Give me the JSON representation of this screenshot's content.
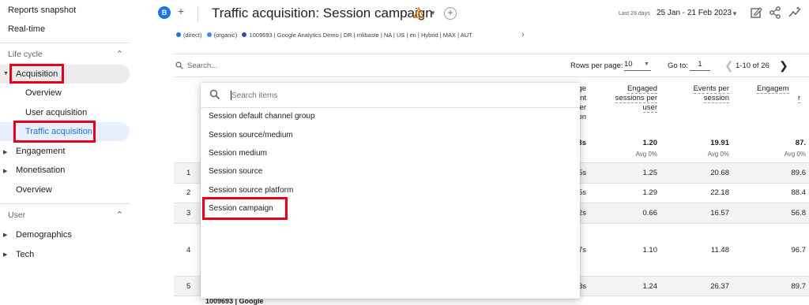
{
  "sidebar": {
    "reports_snapshot": "Reports snapshot",
    "realtime": "Real-time",
    "life_cycle": "Life cycle",
    "acquisition": "Acquisition",
    "overview": "Overview",
    "user_acquisition": "User acquisition",
    "traffic_acquisition": "Traffic acquisition",
    "engagement": "Engagement",
    "monetisation": "Monetisation",
    "overview2": "Overview",
    "user": "User",
    "demographics": "Demographics",
    "tech": "Tech"
  },
  "header": {
    "avatar_letter": "B",
    "title": "Traffic acquisition: Session campaign",
    "date_label": "Last 28 days",
    "date_range": "25 Jan - 21 Feb 2023"
  },
  "legend": [
    {
      "label": "(direct)",
      "color": "#1a73e8"
    },
    {
      "label": "(organic)",
      "color": "#4285f4"
    },
    {
      "label": "1009693 | Google Analytics Demo | DR | mlibaste | NA | US | en | Hybrid | MAX | AUT",
      "color": "#3949ab"
    }
  ],
  "table": {
    "search_placeholder": "Search...",
    "rows_per_page_label": "Rows per page:",
    "rows_per_page": "10",
    "goto_label": "Go to:",
    "goto_value": "1",
    "pager": "1-10 of 26",
    "headers": {
      "partial_top": "ge",
      "partial_2": "nt",
      "partial_3": "er",
      "partial_4": "on",
      "engaged_1": "Engaged",
      "engaged_2": "sessions per",
      "engaged_3": "user",
      "events_1": "Events per",
      "events_2": "session",
      "engagement_1": "Engagem",
      "engagement_2": "r"
    },
    "totals": {
      "partial": "3s",
      "engaged": "1.20",
      "engaged_avg": "Avg 0%",
      "events": "19.91",
      "events_avg": "Avg 0%",
      "engagement": "87.",
      "engagement_avg": "Avg 0%"
    },
    "rows": [
      {
        "num": "1",
        "partial": "5s",
        "engaged": "1.25",
        "events": "20.68",
        "engagement": "89.6"
      },
      {
        "num": "2",
        "partial": "5s",
        "engaged": "1.29",
        "events": "22.18",
        "engagement": "88.4"
      },
      {
        "num": "3",
        "partial": "2s",
        "engaged": "0.66",
        "events": "16.57",
        "engagement": "56.8"
      },
      {
        "num": "4",
        "partial": "7s",
        "engaged": "1.10",
        "events": "11.48",
        "engagement": "96.7"
      },
      {
        "num": "5",
        "partial": "3s",
        "engaged": "1.24",
        "events": "26.37",
        "engagement": "89.7"
      }
    ],
    "bottom_label": "1009693 | Google"
  },
  "dropdown": {
    "search_placeholder": "Search items",
    "items": [
      "Session default channel group",
      "Session source/medium",
      "Session medium",
      "Session source",
      "Session source platform",
      "Session campaign"
    ]
  },
  "colors": {
    "accent": "#1a73e8",
    "highlight": "#e8001c",
    "warning": "#e37400"
  }
}
